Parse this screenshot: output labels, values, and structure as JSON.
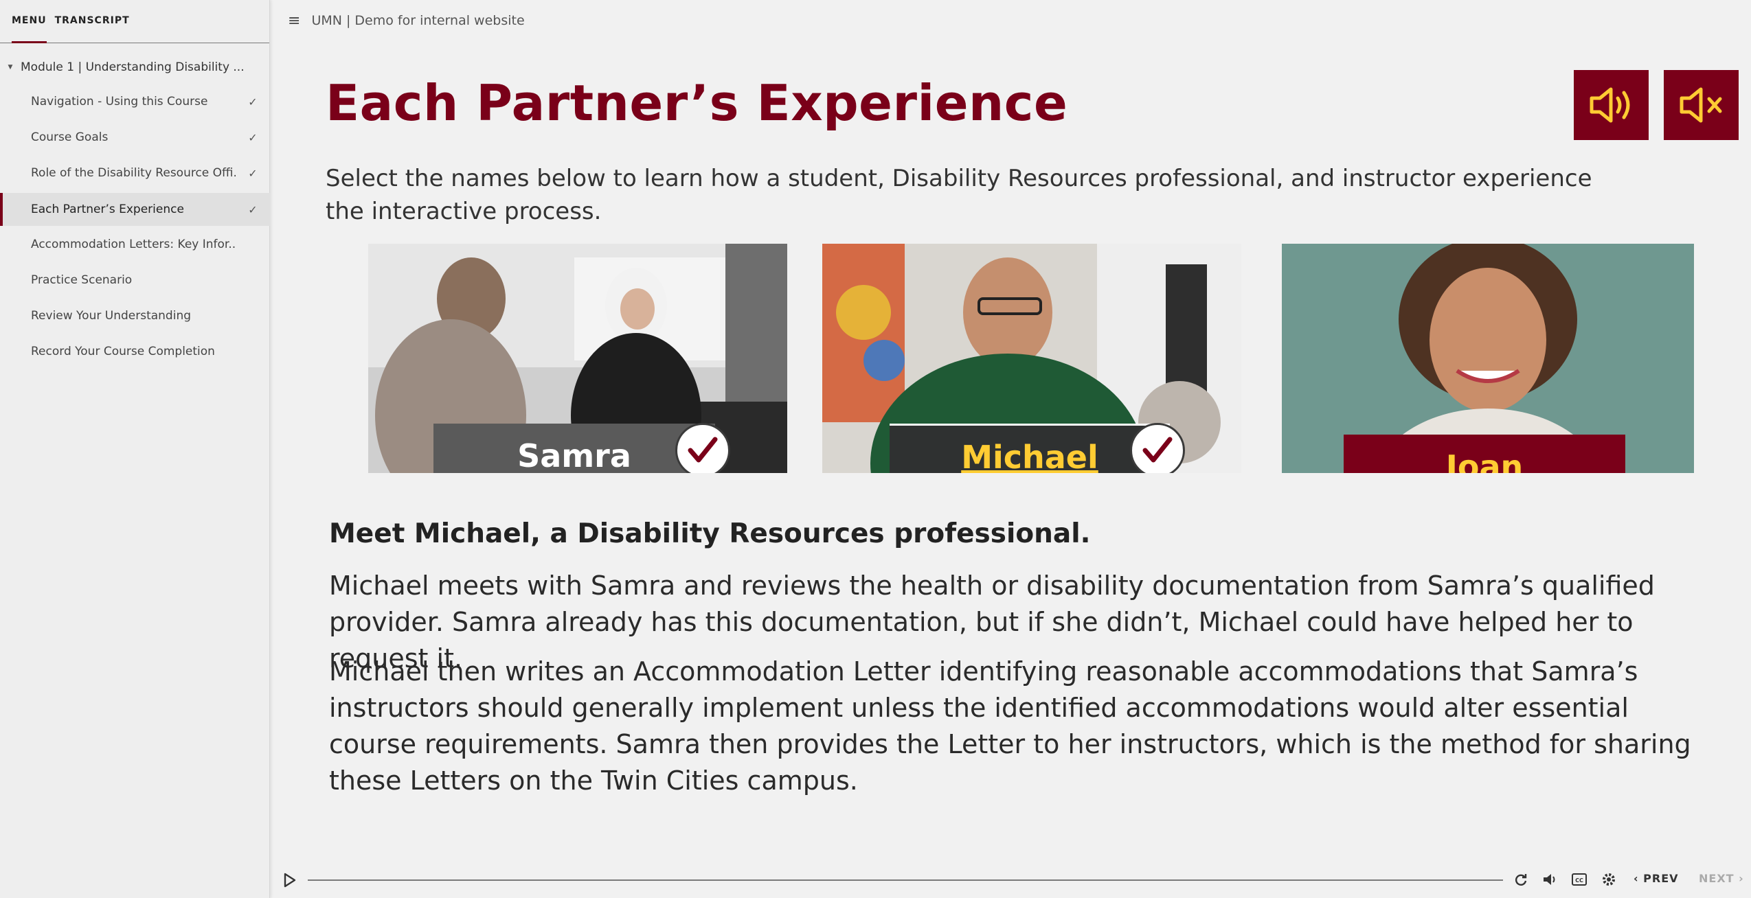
{
  "sidebar": {
    "tabs": [
      "MENU",
      "TRANSCRIPT"
    ],
    "module_title": "Module 1 | Understanding Disability ...",
    "items": [
      {
        "label": "Navigation - Using this Course",
        "completed": true
      },
      {
        "label": "Course Goals",
        "completed": true
      },
      {
        "label": "Role of the Disability Resource Offi...",
        "completed": true
      },
      {
        "label": "Each Partner’s Experience",
        "completed": true,
        "active": true
      },
      {
        "label": "Accommodation Letters: Key Infor...",
        "completed": false
      },
      {
        "label": "Practice Scenario",
        "completed": false
      },
      {
        "label": "Review Your Understanding",
        "completed": false
      },
      {
        "label": "Record Your Course Completion",
        "completed": false
      }
    ]
  },
  "header": {
    "title": "UMN | Demo for internal website"
  },
  "slide": {
    "title": "Each Partner’s Experience",
    "intro": "Select the names below to learn how a student, Disability Resources professional, and instructor experience the interactive process.",
    "cards": [
      {
        "name": "Samra",
        "visited": true
      },
      {
        "name": "Michael",
        "visited": true
      },
      {
        "name": "Joan",
        "visited": false
      }
    ],
    "heading": "Meet Michael, a Disability Resources professional.",
    "paragraph1": "Michael meets with Samra and reviews the health or disability documentation from Samra’s qualified provider. Samra already has this documentation, but if she didn’t, Michael could have helped her to request it.",
    "paragraph2": "Michael then writes an Accommodation Letter identifying reasonable accommodations that Samra’s instructors should generally implement unless the identified accommodations would alter essential course requirements. Samra then provides the Letter to her instructors, which is the method for sharing these Letters on the Twin Cities campus."
  },
  "player": {
    "prev_label": "PREV",
    "next_label": "NEXT",
    "progress": 0
  },
  "colors": {
    "brand_maroon": "#7a0019",
    "gold": "#ffcc33",
    "plate_gray": "#5a5a5a",
    "plate_dark": "#2f3131"
  },
  "icons": [
    "hamburger-icon",
    "audio-on-icon",
    "audio-mute-icon",
    "check-icon",
    "play-icon",
    "replay-icon",
    "volume-icon",
    "captions-icon",
    "settings-icon"
  ]
}
